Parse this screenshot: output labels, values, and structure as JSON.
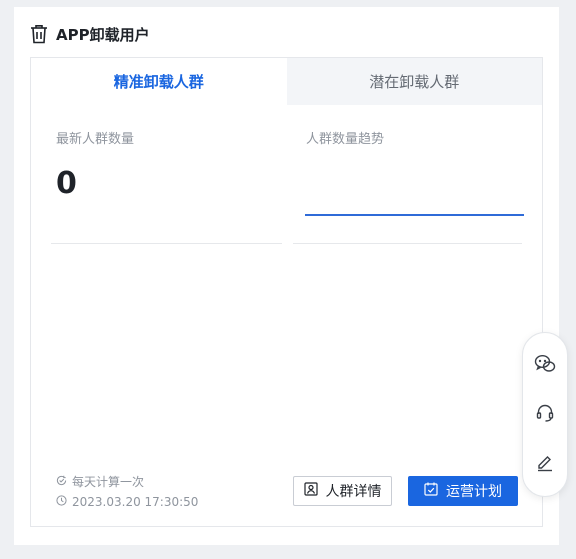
{
  "header": {
    "title": "APP卸载用户",
    "icon": "trash-icon"
  },
  "tabs": [
    {
      "label": "精准卸载人群",
      "active": true
    },
    {
      "label": "潜在卸载人群",
      "active": false
    }
  ],
  "metrics": {
    "latest_label": "最新人群数量",
    "latest_value": "0",
    "trend_label": "人群数量趋势"
  },
  "footer": {
    "calc_note": "每天计算一次",
    "timestamp": "2023.03.20 17:30:50",
    "detail_button": "人群详情",
    "plan_button": "运营计划"
  },
  "float_toolbar": {
    "items": [
      "wechat-icon",
      "headset-icon",
      "edit-icon"
    ]
  },
  "colors": {
    "accent": "#1a66e0",
    "text": "#1f2329",
    "muted": "#8f959e",
    "page_bg": "#eef0f3"
  }
}
